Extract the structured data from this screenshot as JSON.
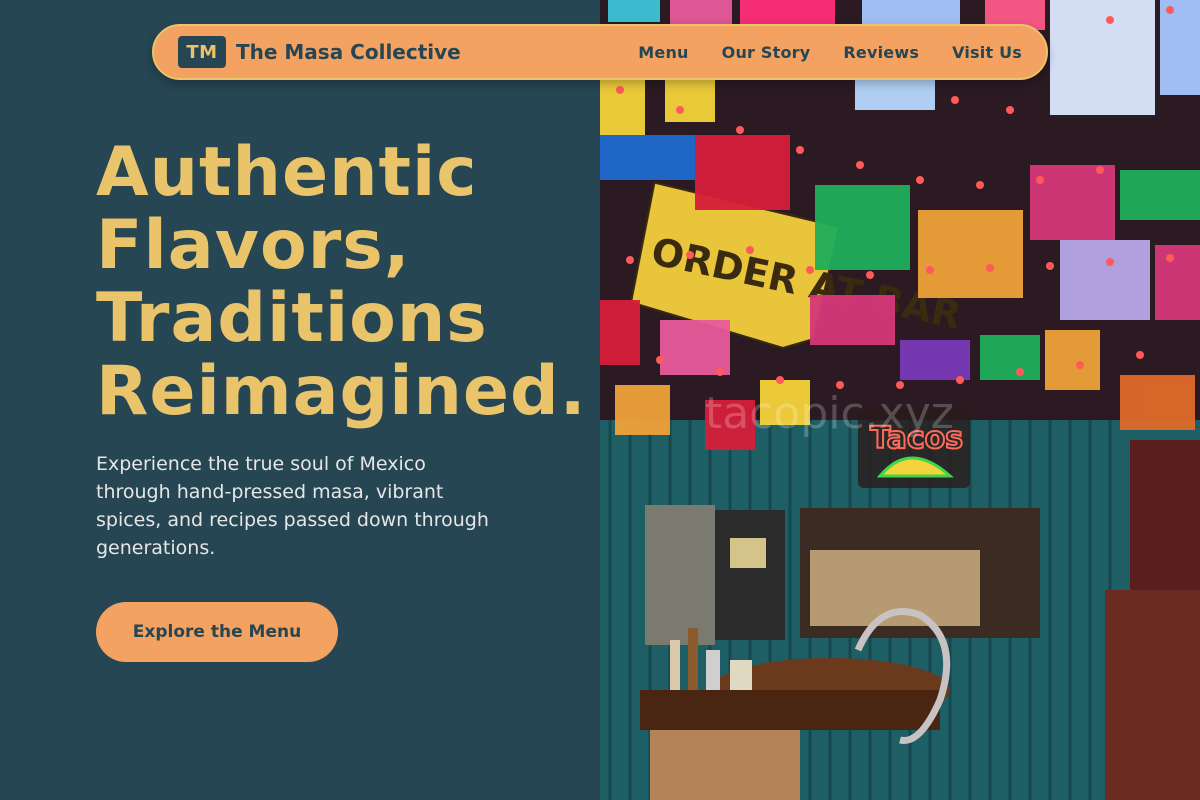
{
  "brand": {
    "initials": "TM",
    "name": "The Masa Collective"
  },
  "nav": {
    "items": [
      {
        "label": "Menu"
      },
      {
        "label": "Our Story"
      },
      {
        "label": "Reviews"
      },
      {
        "label": "Visit Us"
      }
    ]
  },
  "hero": {
    "title_lines": [
      "Authentic",
      "Flavors,",
      "Traditions",
      "Reimagined."
    ],
    "subtitle": "Experience the true soul of Mexico through hand-pressed masa, vibrant spices, and recipes passed down through generations.",
    "cta_label": "Explore the Menu"
  },
  "photo": {
    "bar_sign": "ORDER AT BAR",
    "neon_sign": "Tacos",
    "watermark": "tacopic.xyz"
  },
  "colors": {
    "background": "#264653",
    "accent": "#f4a261",
    "title": "#e9c46a",
    "text_light": "#e6e6e6"
  }
}
